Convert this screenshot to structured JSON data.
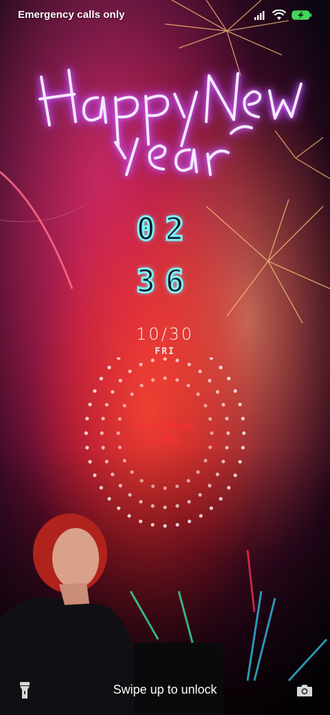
{
  "status_bar": {
    "carrier_text": "Emergency calls only",
    "icons": [
      "signal-icon",
      "wifi-icon",
      "battery-charging-icon"
    ],
    "battery_color": "#44d65a"
  },
  "wallpaper": {
    "greeting": "Happy New Year"
  },
  "clock": {
    "hours": "02",
    "minutes": "36",
    "accent_color": "#7ff4ff"
  },
  "date": {
    "date_text": "10/30",
    "weekday_text": "FRI"
  },
  "charging": {
    "status_label": "Fully Charged",
    "percent_text": "100%",
    "percent_value": 100,
    "color": "#ff2a3a"
  },
  "bottom": {
    "unlock_hint": "Swipe up to unlock",
    "left_icon": "flashlight-icon",
    "right_icon": "camera-icon"
  }
}
